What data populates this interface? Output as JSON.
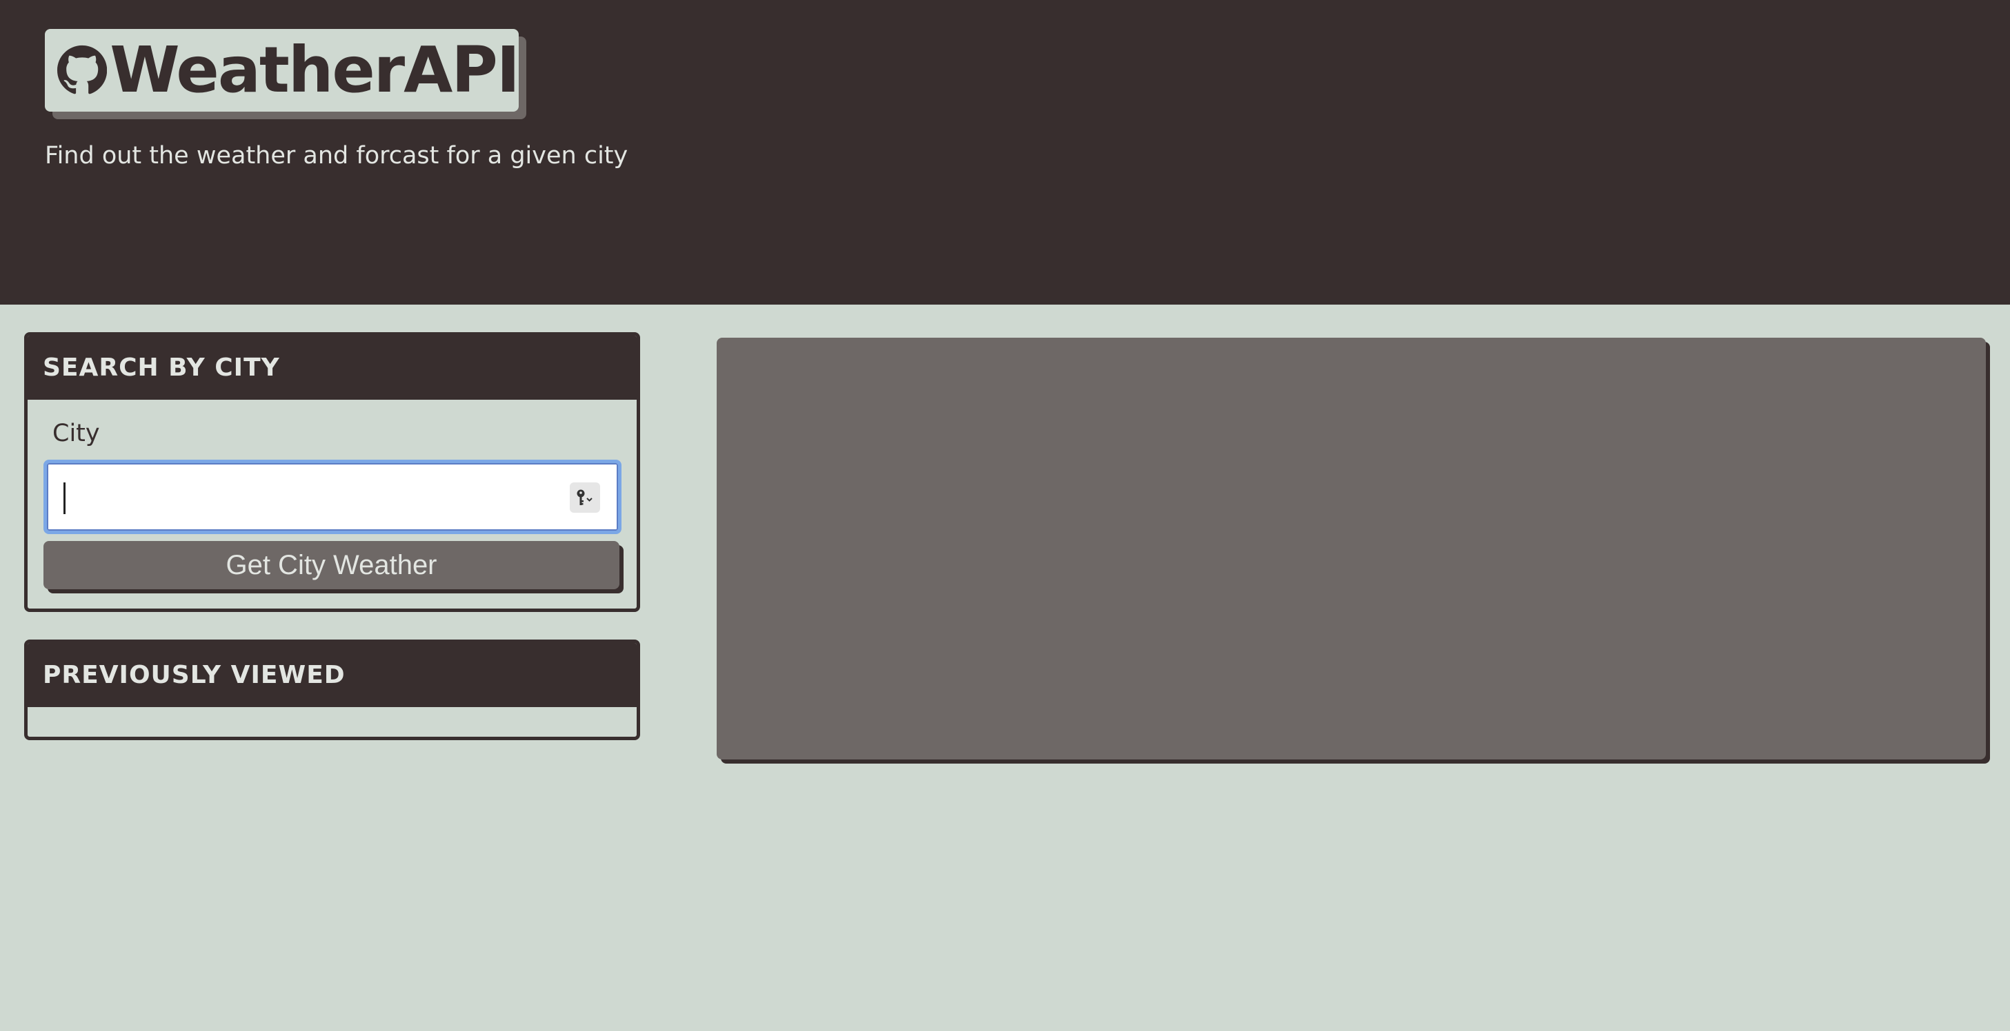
{
  "header": {
    "brand": "WeatherAPI",
    "logo_icon": "github-icon",
    "subtitle": "Find out the weather and forcast for a given city"
  },
  "search": {
    "heading": "SEARCH BY CITY",
    "city_label": "City",
    "city_value": "",
    "input_trailing_icon": "key-icon",
    "button_label": "Get City Weather"
  },
  "previous": {
    "heading": "PREVIOUSLY VIEWED",
    "items": []
  },
  "colors": {
    "header_bg": "#382e2e",
    "page_bg": "#cfd9d1",
    "panel_grey": "#6e6866",
    "light_text": "#e3e6e2",
    "focus_ring": "#7ba7e6"
  }
}
